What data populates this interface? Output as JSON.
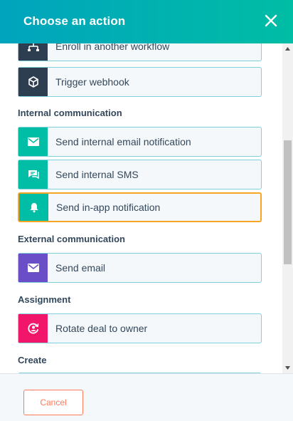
{
  "header": {
    "title": "Choose an action",
    "close_icon": "close-icon"
  },
  "actions_top": [
    {
      "label": "Enroll in another workflow",
      "icon": "workflow-icon",
      "color": "#2d3e50"
    },
    {
      "label": "Trigger webhook",
      "icon": "cube-icon",
      "color": "#2d3e50"
    }
  ],
  "sections": {
    "internal": "Internal communication",
    "external": "External communication",
    "assignment": "Assignment",
    "create": "Create"
  },
  "actions_internal": [
    {
      "label": "Send internal email notification",
      "icon": "email-icon",
      "color": "#00bda5"
    },
    {
      "label": "Send internal SMS",
      "icon": "chat-icon",
      "color": "#00bda5"
    },
    {
      "label": "Send in-app notification",
      "icon": "bell-icon",
      "color": "#00bda5",
      "selected": true
    }
  ],
  "actions_external": [
    {
      "label": "Send email",
      "icon": "email-icon",
      "color": "#6a4ec8"
    }
  ],
  "actions_assignment": [
    {
      "label": "Rotate deal to owner",
      "icon": "rotate-owner-icon",
      "color": "#f2166b"
    }
  ],
  "footer": {
    "cancel_label": "Cancel"
  },
  "colors": {
    "accent": "#00a4bd",
    "selected_border": "#f5a623",
    "cancel": "#ff7a59"
  }
}
